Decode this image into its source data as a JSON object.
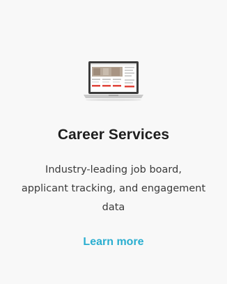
{
  "card": {
    "title": "Career Services",
    "description": "Industry-leading job board, applicant tracking, and engagement data",
    "link_label": "Learn more",
    "illustration_icon": "laptop-screen-icon"
  },
  "colors": {
    "card_background": "#f8f8f8",
    "title": "#1e1e1e",
    "description": "#3a3a3a",
    "link": "#2aaed0",
    "accent_red": "#e0443a"
  }
}
